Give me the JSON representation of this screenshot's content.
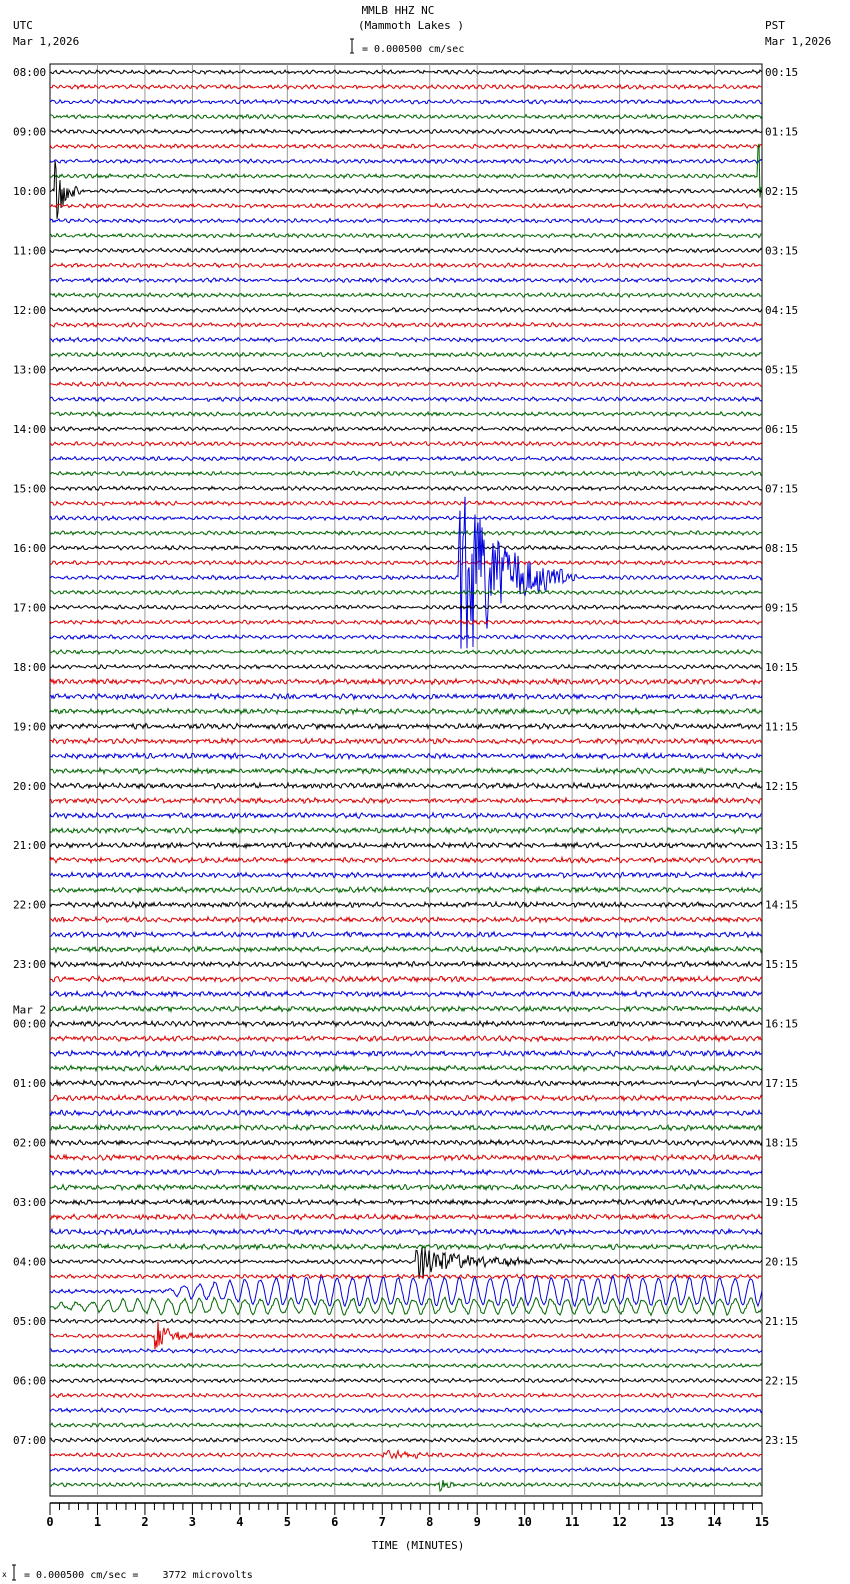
{
  "chart_data": {
    "type": "line",
    "subtype": "helicorder",
    "title": "MMLB HHZ NC",
    "subtitle": "(Mammoth Lakes )",
    "scale_label": "= 0.000500 cm/sec",
    "left_timezone": "UTC",
    "left_date": "Mar 1,2026",
    "right_timezone": "PST",
    "right_date": "Mar 1,2026",
    "date_change_label": "Mar 2",
    "xlabel": "TIME (MINUTES)",
    "xlim": [
      0,
      15
    ],
    "x_ticks": [
      "0",
      "1",
      "2",
      "3",
      "4",
      "5",
      "6",
      "7",
      "8",
      "9",
      "10",
      "11",
      "12",
      "13",
      "14",
      "15"
    ],
    "traces_per_hour": 4,
    "trace_colors": [
      "#000000",
      "#dd0000",
      "#0000dd",
      "#006600"
    ],
    "left_hour_labels": [
      "08:00",
      "09:00",
      "10:00",
      "11:00",
      "12:00",
      "13:00",
      "14:00",
      "15:00",
      "16:00",
      "17:00",
      "18:00",
      "19:00",
      "20:00",
      "21:00",
      "22:00",
      "23:00",
      "00:00",
      "01:00",
      "02:00",
      "03:00",
      "04:00",
      "05:00",
      "06:00",
      "07:00"
    ],
    "right_hour_labels": [
      "00:15",
      "01:15",
      "02:15",
      "03:15",
      "04:15",
      "05:15",
      "06:15",
      "07:15",
      "08:15",
      "09:15",
      "10:15",
      "11:15",
      "12:15",
      "13:15",
      "14:15",
      "15:15",
      "16:15",
      "17:15",
      "18:15",
      "19:15",
      "20:15",
      "21:15",
      "22:15",
      "23:15"
    ],
    "events": [
      {
        "trace": 7,
        "minute": 14.9,
        "amplitude": 5,
        "duration": 0.2
      },
      {
        "trace": 8,
        "minute": 0.1,
        "amplitude": 2.5,
        "duration": 0.6
      },
      {
        "trace": 34,
        "minute": 8.6,
        "amplitude": 7,
        "duration": 2.5
      },
      {
        "trace": 80,
        "minute": 7.7,
        "amplitude": 1.3,
        "duration": 3
      },
      {
        "trace": 85,
        "minute": 2.2,
        "amplitude": 1.2,
        "duration": 1
      },
      {
        "trace": 93,
        "minute": 7.0,
        "amplitude": 0.5,
        "duration": 1.5
      },
      {
        "trace": 95,
        "minute": 8.2,
        "amplitude": 0.8,
        "duration": 0.4
      }
    ],
    "long_period_waves": [
      {
        "trace": 82,
        "start_minute": 2.5,
        "amplitude": 1.5
      },
      {
        "trace": 83,
        "start_minute": 0,
        "amplitude": 0.8
      }
    ],
    "footer": {
      "scale_text": "= 0.000500 cm/sec =    3772 microvolts"
    }
  }
}
